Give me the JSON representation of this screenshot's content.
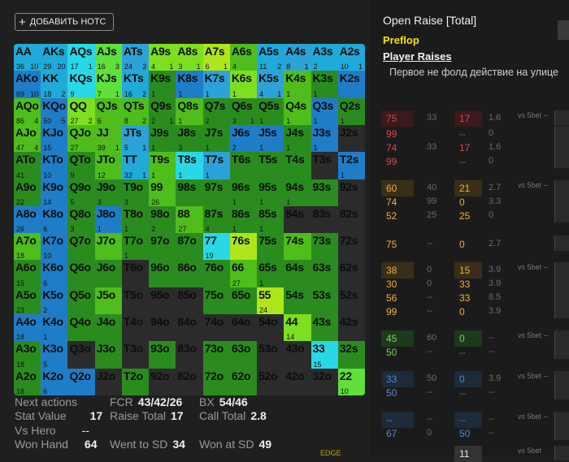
{
  "toolbar": {
    "add_note_label": "ДОБАВИТЬ НОТС"
  },
  "grid": {
    "cells": [
      {
        "h": "AA",
        "n": "36",
        "m": "10",
        "c": "#1faad9"
      },
      {
        "h": "AKs",
        "n": "29",
        "m": "20",
        "c": "#1faad9"
      },
      {
        "h": "AQs",
        "n": "17",
        "m": "1",
        "c": "#29d8e6"
      },
      {
        "h": "AJs",
        "n": "16",
        "m": "3",
        "c": "#5fe03a"
      },
      {
        "h": "ATs",
        "n": "24",
        "m": "3",
        "c": "#2da2d8"
      },
      {
        "h": "A9s",
        "n": "4",
        "m": "1",
        "c": "#7ddf1f"
      },
      {
        "h": "A8s",
        "n": "3",
        "m": "1",
        "c": "#7ddf1f"
      },
      {
        "h": "A7s",
        "n": "6",
        "m": "1",
        "c": "#aee61a"
      },
      {
        "h": "A6s",
        "n": "4",
        "m": "",
        "c": "#4fbd1b"
      },
      {
        "h": "A5s",
        "n": "11",
        "m": "2",
        "c": "#1faad9"
      },
      {
        "h": "A4s",
        "n": "8",
        "m": "1",
        "c": "#2da2d8"
      },
      {
        "h": "A3s",
        "n": "2",
        "m": "",
        "c": "#1faad9"
      },
      {
        "h": "A2s",
        "n": "10",
        "m": "1",
        "c": "#1faad9"
      },
      {
        "h": "AKo",
        "n": "69",
        "m": "10",
        "c": "#1f7dc8"
      },
      {
        "h": "KK",
        "n": "18",
        "m": "2",
        "c": "#1faad9"
      },
      {
        "h": "KQs",
        "n": "9",
        "m": "",
        "c": "#29d8e6"
      },
      {
        "h": "KJs",
        "n": "7",
        "m": "1",
        "c": "#5fe03a"
      },
      {
        "h": "KTs",
        "n": "16",
        "m": "2",
        "c": "#1faad9"
      },
      {
        "h": "K9s",
        "n": "1",
        "m": "",
        "c": "#2a8c1e"
      },
      {
        "h": "K8s",
        "n": "1",
        "m": "",
        "c": "#1f7dc8"
      },
      {
        "h": "K7s",
        "n": "1",
        "m": "",
        "c": "#2da2d8"
      },
      {
        "h": "K6s",
        "n": "1",
        "m": "",
        "c": "#7ddf1f"
      },
      {
        "h": "K5s",
        "n": "4",
        "m": "1",
        "c": "#2da2d8"
      },
      {
        "h": "K4s",
        "n": "1",
        "m": "",
        "c": "#4fbd1b"
      },
      {
        "h": "K3s",
        "n": "1",
        "m": "",
        "c": "#2a8c1e"
      },
      {
        "h": "K2s",
        "n": "",
        "m": "",
        "c": "#1f7dc8"
      },
      {
        "h": "AQo",
        "n": "86",
        "m": "4",
        "c": "#4fbd1b"
      },
      {
        "h": "KQo",
        "n": "50",
        "m": "5",
        "c": "#1f7dc8"
      },
      {
        "h": "QQ",
        "n": "27",
        "m": "2",
        "c": "#7ddf1f"
      },
      {
        "h": "QJs",
        "n": "6",
        "m": "",
        "c": "#4fbd1b"
      },
      {
        "h": "QTs",
        "n": "8",
        "m": "2",
        "c": "#4fbd1b"
      },
      {
        "h": "Q9s",
        "n": "2",
        "m": "1",
        "c": "#2a8c1e"
      },
      {
        "h": "Q8s",
        "n": "1",
        "m": "",
        "c": "#4fbd1b"
      },
      {
        "h": "Q7s",
        "n": "2",
        "m": "",
        "c": "#2a8c1e"
      },
      {
        "h": "Q6s",
        "n": "3",
        "m": "1",
        "c": "#2a8c1e"
      },
      {
        "h": "Q5s",
        "n": "1",
        "m": "",
        "c": "#2a8c1e"
      },
      {
        "h": "Q4s",
        "n": "1",
        "m": "",
        "c": "#4fbd1b"
      },
      {
        "h": "Q3s",
        "n": "1",
        "m": "",
        "c": "#1f7dc8"
      },
      {
        "h": "Q2s",
        "n": "1",
        "m": "",
        "c": "#2a8c1e"
      },
      {
        "h": "AJo",
        "n": "47",
        "m": "4",
        "c": "#4fbd1b"
      },
      {
        "h": "KJo",
        "n": "15",
        "m": "",
        "c": "#1f7dc8"
      },
      {
        "h": "QJo",
        "n": "27",
        "m": "",
        "c": "#4fbd1b"
      },
      {
        "h": "JJ",
        "n": "39",
        "m": "1",
        "c": "#4fbd1b"
      },
      {
        "h": "JTs",
        "n": "5",
        "m": "1",
        "c": "#2da2d8"
      },
      {
        "h": "J9s",
        "n": "1",
        "m": "",
        "c": "#2a8c1e"
      },
      {
        "h": "J8s",
        "n": "3",
        "m": "",
        "c": "#2a8c1e"
      },
      {
        "h": "J7s",
        "n": "1",
        "m": "",
        "c": "#2a8c1e"
      },
      {
        "h": "J6s",
        "n": "2",
        "m": "",
        "c": "#1f7dc8"
      },
      {
        "h": "J5s",
        "n": "1",
        "m": "",
        "c": "#1f7dc8"
      },
      {
        "h": "J4s",
        "n": "1",
        "m": "",
        "c": "#2a8c1e"
      },
      {
        "h": "J3s",
        "n": "1",
        "m": "",
        "c": "#1f7dc8"
      },
      {
        "h": "J2s",
        "n": "",
        "m": "",
        "c": "#2b2b2b"
      },
      {
        "h": "ATo",
        "n": "41",
        "m": "",
        "c": "#2a8c1e"
      },
      {
        "h": "KTo",
        "n": "10",
        "m": "",
        "c": "#1f7dc8"
      },
      {
        "h": "QTo",
        "n": "9",
        "m": "",
        "c": "#2a8c1e"
      },
      {
        "h": "JTo",
        "n": "12",
        "m": "",
        "c": "#4fbd1b"
      },
      {
        "h": "TT",
        "n": "32",
        "m": "1",
        "c": "#1faad9"
      },
      {
        "h": "T9s",
        "n": "1",
        "m": "",
        "c": "#4fbd1b"
      },
      {
        "h": "T8s",
        "n": "1",
        "m": "",
        "c": "#29d8e6"
      },
      {
        "h": "T7s",
        "n": "1",
        "m": "",
        "c": "#2da2d8"
      },
      {
        "h": "T6s",
        "n": "",
        "m": "",
        "c": "#2a8c1e"
      },
      {
        "h": "T5s",
        "n": "",
        "m": "",
        "c": "#2a8c1e"
      },
      {
        "h": "T4s",
        "n": "",
        "m": "",
        "c": "#2a8c1e"
      },
      {
        "h": "T3s",
        "n": "",
        "m": "",
        "c": "#2b2b2b"
      },
      {
        "h": "T2s",
        "n": "1",
        "m": "",
        "c": "#1f7dc8"
      },
      {
        "h": "A9o",
        "n": "22",
        "m": "",
        "c": "#2a8c1e"
      },
      {
        "h": "K9o",
        "n": "14",
        "m": "",
        "c": "#1f7dc8"
      },
      {
        "h": "Q9o",
        "n": "5",
        "m": "",
        "c": "#2a8c1e"
      },
      {
        "h": "J9o",
        "n": "3",
        "m": "",
        "c": "#2a8c1e"
      },
      {
        "h": "T9o",
        "n": "3",
        "m": "",
        "c": "#2a8c1e"
      },
      {
        "h": "99",
        "n": "26",
        "m": "",
        "c": "#4fbd1b"
      },
      {
        "h": "98s",
        "n": "",
        "m": "",
        "c": "#2a8c1e"
      },
      {
        "h": "97s",
        "n": "",
        "m": "",
        "c": "#2a8c1e"
      },
      {
        "h": "96s",
        "n": "1",
        "m": "",
        "c": "#2a8c1e"
      },
      {
        "h": "95s",
        "n": "1",
        "m": "",
        "c": "#2a8c1e"
      },
      {
        "h": "94s",
        "n": "1",
        "m": "",
        "c": "#2a8c1e"
      },
      {
        "h": "93s",
        "n": "",
        "m": "",
        "c": "#2a8c1e"
      },
      {
        "h": "92s",
        "n": "",
        "m": "",
        "c": "#2b2b2b"
      },
      {
        "h": "A8o",
        "n": "26",
        "m": "",
        "c": "#1f7dc8"
      },
      {
        "h": "K8o",
        "n": "6",
        "m": "",
        "c": "#1f7dc8"
      },
      {
        "h": "Q8o",
        "n": "3",
        "m": "",
        "c": "#2a8c1e"
      },
      {
        "h": "J8o",
        "n": "1",
        "m": "",
        "c": "#1f7dc8"
      },
      {
        "h": "T8o",
        "n": "1",
        "m": "",
        "c": "#2a8c1e"
      },
      {
        "h": "98o",
        "n": "2",
        "m": "",
        "c": "#2a8c1e"
      },
      {
        "h": "88",
        "n": "27",
        "m": "",
        "c": "#4fbd1b"
      },
      {
        "h": "87s",
        "n": "4",
        "m": "",
        "c": "#2a8c1e"
      },
      {
        "h": "86s",
        "n": "1",
        "m": "",
        "c": "#2a8c1e"
      },
      {
        "h": "85s",
        "n": "1",
        "m": "",
        "c": "#2a8c1e"
      },
      {
        "h": "84s",
        "n": "",
        "m": "",
        "c": "#2b2b2b"
      },
      {
        "h": "83s",
        "n": "",
        "m": "",
        "c": "#2b2b2b"
      },
      {
        "h": "82s",
        "n": "",
        "m": "",
        "c": "#2b2b2b"
      },
      {
        "h": "A7o",
        "n": "18",
        "m": "",
        "c": "#4fbd1b"
      },
      {
        "h": "K7o",
        "n": "10",
        "m": "",
        "c": "#1f7dc8"
      },
      {
        "h": "Q7o",
        "n": "",
        "m": "",
        "c": "#2a8c1e"
      },
      {
        "h": "J7o",
        "n": "",
        "m": "",
        "c": "#4fbd1b"
      },
      {
        "h": "T7o",
        "n": "1",
        "m": "",
        "c": "#2a8c1e"
      },
      {
        "h": "97o",
        "n": "",
        "m": "",
        "c": "#2a8c1e"
      },
      {
        "h": "87o",
        "n": "",
        "m": "",
        "c": "#2a8c1e"
      },
      {
        "h": "77",
        "n": "19",
        "m": "",
        "c": "#29d8e6"
      },
      {
        "h": "76s",
        "n": "",
        "m": "",
        "c": "#aee61a"
      },
      {
        "h": "75s",
        "n": "",
        "m": "",
        "c": "#2a8c1e"
      },
      {
        "h": "74s",
        "n": "",
        "m": "",
        "c": "#4fbd1b"
      },
      {
        "h": "73s",
        "n": "",
        "m": "",
        "c": "#2a8c1e"
      },
      {
        "h": "72s",
        "n": "",
        "m": "",
        "c": "#2b2b2b"
      },
      {
        "h": "A6o",
        "n": "15",
        "m": "",
        "c": "#2a8c1e"
      },
      {
        "h": "K6o",
        "n": "6",
        "m": "",
        "c": "#1f7dc8"
      },
      {
        "h": "Q6o",
        "n": "",
        "m": "",
        "c": "#2a8c1e"
      },
      {
        "h": "J6o",
        "n": "",
        "m": "",
        "c": "#2a8c1e"
      },
      {
        "h": "T6o",
        "n": "",
        "m": "",
        "c": "#2b2b2b"
      },
      {
        "h": "96o",
        "n": "",
        "m": "",
        "c": "#2a8c1e"
      },
      {
        "h": "86o",
        "n": "",
        "m": "",
        "c": "#2a8c1e"
      },
      {
        "h": "76o",
        "n": "",
        "m": "",
        "c": "#2a8c1e"
      },
      {
        "h": "66",
        "n": "27",
        "m": "",
        "c": "#4fbd1b"
      },
      {
        "h": "65s",
        "n": "1",
        "m": "",
        "c": "#2a8c1e"
      },
      {
        "h": "64s",
        "n": "",
        "m": "",
        "c": "#2a8c1e"
      },
      {
        "h": "63s",
        "n": "",
        "m": "",
        "c": "#2a8c1e"
      },
      {
        "h": "62s",
        "n": "",
        "m": "",
        "c": "#2b2b2b"
      },
      {
        "h": "A5o",
        "n": "23",
        "m": "",
        "c": "#2a8c1e"
      },
      {
        "h": "K5o",
        "n": "2",
        "m": "",
        "c": "#1f7dc8"
      },
      {
        "h": "Q5o",
        "n": "",
        "m": "",
        "c": "#2a8c1e"
      },
      {
        "h": "J5o",
        "n": "",
        "m": "",
        "c": "#4fbd1b"
      },
      {
        "h": "T5o",
        "n": "",
        "m": "",
        "c": "#2b2b2b"
      },
      {
        "h": "95o",
        "n": "",
        "m": "",
        "c": "#2b2b2b"
      },
      {
        "h": "85o",
        "n": "",
        "m": "",
        "c": "#2b2b2b"
      },
      {
        "h": "75o",
        "n": "",
        "m": "",
        "c": "#2a8c1e"
      },
      {
        "h": "65o",
        "n": "",
        "m": "",
        "c": "#2a8c1e"
      },
      {
        "h": "55",
        "n": "24",
        "m": "",
        "c": "#aee61a"
      },
      {
        "h": "54s",
        "n": "",
        "m": "",
        "c": "#2a8c1e"
      },
      {
        "h": "53s",
        "n": "",
        "m": "",
        "c": "#2a8c1e"
      },
      {
        "h": "52s",
        "n": "",
        "m": "",
        "c": "#2b2b2b"
      },
      {
        "h": "A4o",
        "n": "18",
        "m": "",
        "c": "#1f7dc8"
      },
      {
        "h": "K4o",
        "n": "1",
        "m": "",
        "c": "#1f7dc8"
      },
      {
        "h": "Q4o",
        "n": "",
        "m": "",
        "c": "#2a8c1e"
      },
      {
        "h": "J4o",
        "n": "",
        "m": "",
        "c": "#2a8c1e"
      },
      {
        "h": "T4o",
        "n": "",
        "m": "",
        "c": "#2b2b2b"
      },
      {
        "h": "94o",
        "n": "",
        "m": "",
        "c": "#2b2b2b"
      },
      {
        "h": "84o",
        "n": "",
        "m": "",
        "c": "#2b2b2b"
      },
      {
        "h": "74o",
        "n": "",
        "m": "",
        "c": "#2b2b2b"
      },
      {
        "h": "64o",
        "n": "",
        "m": "",
        "c": "#2b2b2b"
      },
      {
        "h": "54o",
        "n": "",
        "m": "",
        "c": "#2b2b2b"
      },
      {
        "h": "44",
        "n": "14",
        "m": "",
        "c": "#7ddf1f"
      },
      {
        "h": "43s",
        "n": "",
        "m": "",
        "c": "#2a8c1e"
      },
      {
        "h": "42s",
        "n": "",
        "m": "",
        "c": "#2b2b2b"
      },
      {
        "h": "A3o",
        "n": "18",
        "m": "",
        "c": "#2a8c1e"
      },
      {
        "h": "K3o",
        "n": "5",
        "m": "",
        "c": "#1f7dc8"
      },
      {
        "h": "Q3o",
        "n": "",
        "m": "",
        "c": "#2b2b2b"
      },
      {
        "h": "J3o",
        "n": "",
        "m": "",
        "c": "#2a8c1e"
      },
      {
        "h": "T3o",
        "n": "",
        "m": "",
        "c": "#2b2b2b"
      },
      {
        "h": "93o",
        "n": "",
        "m": "",
        "c": "#2a8c1e"
      },
      {
        "h": "83o",
        "n": "",
        "m": "",
        "c": "#2b2b2b"
      },
      {
        "h": "73o",
        "n": "",
        "m": "",
        "c": "#2a8c1e"
      },
      {
        "h": "63o",
        "n": "",
        "m": "",
        "c": "#2a8c1e"
      },
      {
        "h": "53o",
        "n": "",
        "m": "",
        "c": "#2b2b2b"
      },
      {
        "h": "43o",
        "n": "",
        "m": "",
        "c": "#2b2b2b"
      },
      {
        "h": "33",
        "n": "15",
        "m": "",
        "c": "#29d8e6"
      },
      {
        "h": "32s",
        "n": "",
        "m": "",
        "c": "#2a8c1e"
      },
      {
        "h": "A2o",
        "n": "18",
        "m": "",
        "c": "#2a8c1e"
      },
      {
        "h": "K2o",
        "n": "6",
        "m": "",
        "c": "#1f7dc8"
      },
      {
        "h": "Q2o",
        "n": "",
        "m": "",
        "c": "#1f7dc8"
      },
      {
        "h": "J2o",
        "n": "",
        "m": "",
        "c": "#2b2b2b"
      },
      {
        "h": "T2o",
        "n": "",
        "m": "",
        "c": "#2a8c1e"
      },
      {
        "h": "92o",
        "n": "",
        "m": "",
        "c": "#2b2b2b"
      },
      {
        "h": "82o",
        "n": "",
        "m": "",
        "c": "#2b2b2b"
      },
      {
        "h": "72o",
        "n": "",
        "m": "",
        "c": "#2a8c1e"
      },
      {
        "h": "62o",
        "n": "",
        "m": "",
        "c": "#2a8c1e"
      },
      {
        "h": "52o",
        "n": "",
        "m": "",
        "c": "#2b2b2b"
      },
      {
        "h": "42o",
        "n": "",
        "m": "",
        "c": "#2b2b2b"
      },
      {
        "h": "32o",
        "n": "",
        "m": "",
        "c": "#2b2b2b"
      },
      {
        "h": "22",
        "n": "10",
        "m": "",
        "c": "#5fe03a"
      }
    ]
  },
  "stats": {
    "next_actions": "Next actions",
    "fcr_label": "FCR",
    "fcr_val": "43/42/26",
    "bx_label": "BX",
    "bx_val": "54/46",
    "stat_value_label": "Stat Value",
    "stat_value": "17",
    "raise_total_label": "Raise Total",
    "raise_total": "17",
    "call_total_label": "Call Total",
    "call_total": "2.8",
    "vs_hero_label": "Vs Hero",
    "vs_hero": "--",
    "won_hand_label": "Won Hand",
    "won_hand": "64",
    "went_sd_label": "Went to SD",
    "went_sd": "34",
    "won_sd_label": "Won at SD",
    "won_sd": "49",
    "edge_label": "EDGE"
  },
  "panel": {
    "title": "Open Raise [Total]",
    "preflop": "Preflop",
    "player_raises": "Player Raises",
    "description": "Первое не фолд действие на улице"
  },
  "table_rows": [
    {
      "a": "75",
      "ac": "rd",
      "b": "33",
      "c": "17",
      "cc": "rd",
      "d": "1.6",
      "e": "vs 5bet --",
      "bg": "#3a1a1a",
      "bgc": "#3a1a1a"
    },
    {
      "a": "99",
      "ac": "rd",
      "b": "",
      "c": "--",
      "cc": "gy",
      "d": "0",
      "e": ""
    },
    {
      "a": "74",
      "ac": "rd",
      "b": "33",
      "c": "17",
      "cc": "rd",
      "d": "1.6",
      "e": ""
    },
    {
      "a": "99",
      "ac": "rd",
      "b": "",
      "c": "--",
      "cc": "gy",
      "d": "0",
      "e": ""
    },
    {
      "a": "60",
      "ac": "og",
      "b": "40",
      "c": "21",
      "cc": "og",
      "d": "2.7",
      "e": "vs 5bet --",
      "bg": "#3a2e18",
      "bgc": "#3a2e18"
    },
    {
      "a": "74",
      "ac": "og",
      "b": "99",
      "c": "0",
      "cc": "og",
      "d": "3.3",
      "e": ""
    },
    {
      "a": "52",
      "ac": "og",
      "b": "25",
      "c": "25",
      "cc": "og",
      "d": "0",
      "e": ""
    },
    {
      "a": "",
      "ac": "og",
      "b": "",
      "c": "",
      "cc": "og",
      "d": "",
      "e": ""
    },
    {
      "a": "75",
      "ac": "og",
      "b": "--",
      "c": "0",
      "cc": "og",
      "d": "2.7",
      "e": ""
    },
    {
      "a": "38",
      "ac": "og",
      "b": "0",
      "c": "15",
      "cc": "og",
      "d": "3.9",
      "e": "vs 5bet --",
      "bg": "#3a2e18",
      "bgc": "#3a2e18"
    },
    {
      "a": "30",
      "ac": "og",
      "b": "0",
      "c": "33",
      "cc": "og",
      "d": "3.9",
      "e": ""
    },
    {
      "a": "56",
      "ac": "og",
      "b": "--",
      "c": "33",
      "cc": "og",
      "d": "8.5",
      "e": ""
    },
    {
      "a": "99",
      "ac": "og",
      "b": "--",
      "c": "0",
      "cc": "og",
      "d": "3.9",
      "e": ""
    },
    {
      "a": "45",
      "ac": "gr",
      "b": "60",
      "c": "0",
      "cc": "gr",
      "d": "--",
      "e": "vs 5bet --",
      "bg": "#1d3a1d",
      "bgc": "#1d3a1d"
    },
    {
      "a": "50",
      "ac": "gr",
      "b": "--",
      "c": "--",
      "cc": "gy",
      "d": "--",
      "e": ""
    },
    {
      "a": "33",
      "ac": "bl",
      "b": "50",
      "c": "0",
      "cc": "bl",
      "d": "3.9",
      "e": "vs 5bet --",
      "bg": "#1d2a3a",
      "bgc": "#1d2a3a"
    },
    {
      "a": "50",
      "ac": "bl",
      "b": "--",
      "c": "--",
      "cc": "gy",
      "d": "--",
      "e": ""
    },
    {
      "a": "--",
      "ac": "bl",
      "b": "--",
      "c": "--",
      "cc": "gy",
      "d": "--",
      "e": "vs 5bet --",
      "bg": "#1d2a3a",
      "bgc": "#1d2a3a"
    },
    {
      "a": "67",
      "ac": "bl",
      "b": "0",
      "c": "50",
      "cc": "bl",
      "d": "--",
      "e": ""
    },
    {
      "a": "",
      "ac": "wh",
      "b": "",
      "c": "11",
      "cc": "wh",
      "d": "",
      "e": "vs 5bet",
      "bgc": "#333333"
    }
  ]
}
